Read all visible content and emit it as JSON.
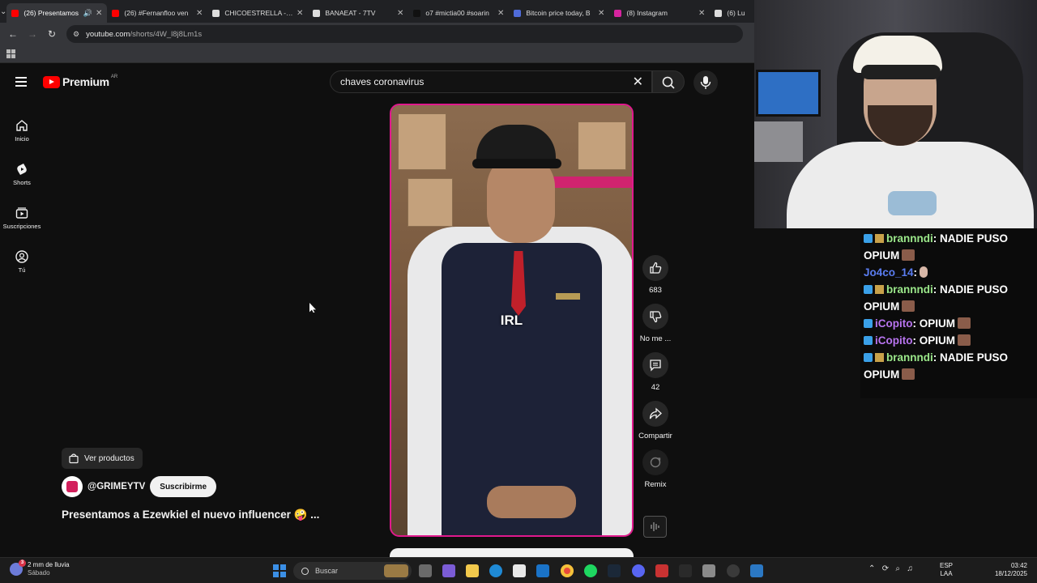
{
  "browser": {
    "tabs": [
      {
        "title": "(26) Presentamos",
        "color": "#ff0000",
        "active": true,
        "audio": true
      },
      {
        "title": "(26) #Fernanfloo ven",
        "color": "#ff0000"
      },
      {
        "title": "CHICOESTRELLA - 7T",
        "color": "#dddddd"
      },
      {
        "title": "BANAEAT - 7TV",
        "color": "#dddddd"
      },
      {
        "title": "o7 #mictia00 #soarin",
        "color": "#111111"
      },
      {
        "title": "Bitcoin price today, B",
        "color": "#4f6bd8"
      },
      {
        "title": "(8) Instagram",
        "color": "#d6249f"
      },
      {
        "title": "(6) Lu",
        "color": "#dddddd"
      }
    ],
    "address": {
      "host": "youtube.com",
      "path": "/shorts/4W_l8j8Lm1s"
    }
  },
  "youtube": {
    "logo_word": "Premium",
    "country": "AR",
    "search_value": "chaves coronavirus",
    "guide": [
      {
        "label": "Inicio",
        "icon": "home-icon"
      },
      {
        "label": "Shorts",
        "icon": "shorts-icon"
      },
      {
        "label": "Suscripciones",
        "icon": "subscriptions-icon"
      },
      {
        "label": "Tú",
        "icon": "you-icon"
      }
    ],
    "video_overlay_text": "IRL",
    "actions": {
      "like_count": "683",
      "dislike_label": "No me ...",
      "comments_count": "42",
      "share_label": "Compartir",
      "remix_label": "Remix"
    },
    "products_label": "Ver productos",
    "channel_name": "@GRIMEYTV",
    "subscribe_label": "Suscribirme",
    "video_title": "Presentamos a Ezewkiel el nuevo influencer 🤪 ...",
    "accent": "#e0198d"
  },
  "chat": {
    "messages": [
      {
        "user": "brannndi",
        "text": ": NADIE PUSO",
        "cont": "OPIUM",
        "color": "#9be88a",
        "badges": 2
      },
      {
        "user": "Jo4co_14",
        "text": ":",
        "cont": "",
        "color": "#5a7cf0",
        "badges": 0
      },
      {
        "user": "brannndi",
        "text": ": NADIE PUSO",
        "cont": "OPIUM",
        "color": "#9be88a",
        "badges": 2
      },
      {
        "user": "iCopito",
        "text": ": OPIUM",
        "cont": "",
        "color": "#b874f0",
        "badges": 1
      },
      {
        "user": "iCopito",
        "text": ": OPIUM",
        "cont": "",
        "color": "#b874f0",
        "badges": 1
      },
      {
        "user": "brannndi",
        "text": ": NADIE PUSO",
        "cont": "OPIUM",
        "color": "#9be88a",
        "badges": 2
      }
    ]
  },
  "taskbar": {
    "weather_line1": "2 mm de lluvia",
    "weather_line2": "Sábado",
    "weather_badge": "3",
    "search_placeholder": "Buscar",
    "lang_line1": "ESP",
    "lang_line2": "LAA",
    "time": "03:42",
    "date": "18/12/2025"
  }
}
